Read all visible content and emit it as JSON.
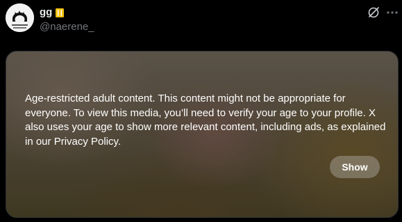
{
  "post": {
    "author": {
      "display_name": "gg",
      "handle": "@naerene_"
    },
    "icons": {
      "avatar": "avatar",
      "verified_badge": "verified-badge-icon",
      "grok": "grok-icon",
      "more": "more-icon"
    },
    "colors": {
      "badge": "#f4c20d",
      "handle": "#71767b",
      "text": "#e7e9ea"
    }
  },
  "media": {
    "warning_text": "Age-restricted adult content. This content might not be appropriate for everyone. To view this media, you’ll need to verify your age to your profile. X also uses your age to show more relevant content, including ads, as explained in our ",
    "policy_link": "Privacy Policy",
    "warning_end": ".",
    "show_label": "Show"
  }
}
